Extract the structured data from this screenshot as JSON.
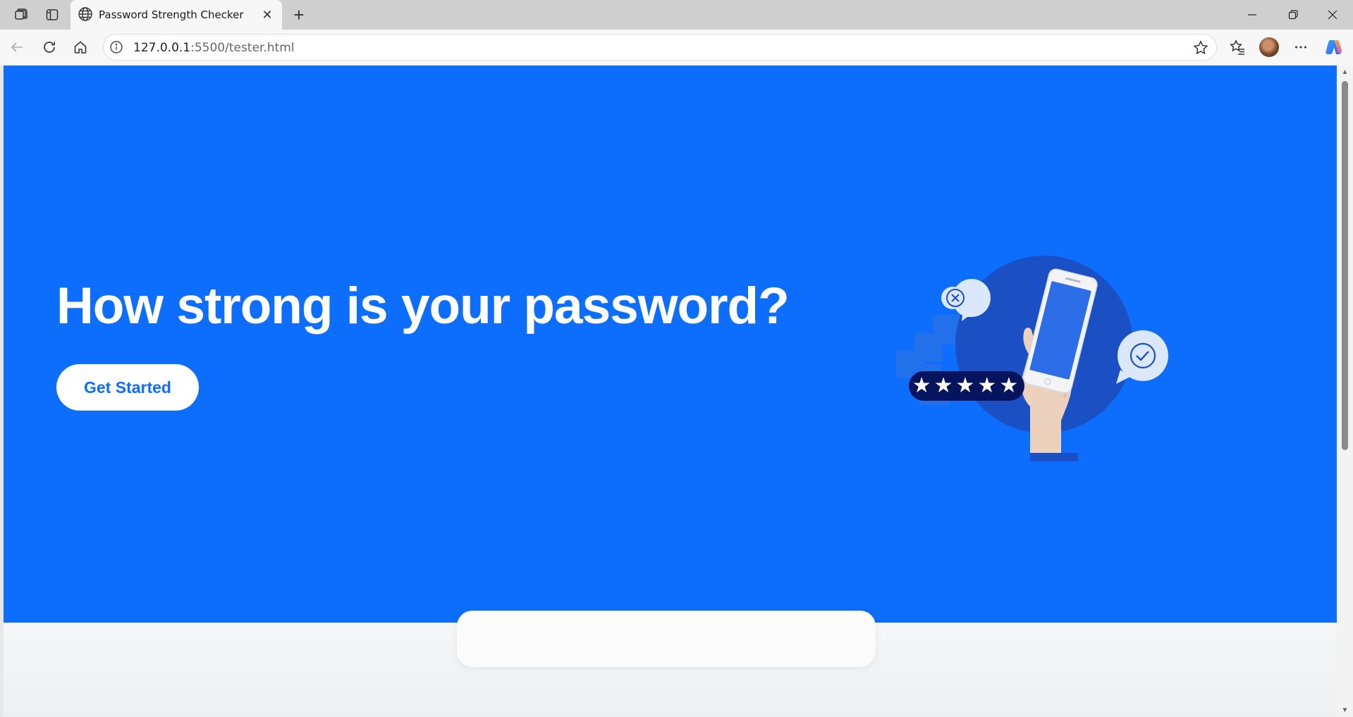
{
  "browser": {
    "tab_title": "Password Strength Checker",
    "tab_close": "✕",
    "new_tab": "+",
    "url_host": "127.0.0.1",
    "url_rest": ":5500/tester.html"
  },
  "hero": {
    "headline": "How strong is your password?",
    "cta_label": "Get Started",
    "illustration_mask": "★★★★★"
  },
  "colors": {
    "hero_bg": "#0d6efd",
    "cta_text": "#0d6efd",
    "dark_circle": "#1b4fc4",
    "mask_pill": "#06145e"
  },
  "icons": {
    "workspaces": "workspaces-icon",
    "vertical_tabs": "vertical-tabs-icon",
    "globe": "globe-icon",
    "back": "back-arrow-icon",
    "reload": "reload-icon",
    "home": "home-icon",
    "site_info": "info-icon",
    "favorite": "star-icon",
    "favorites": "favorites-icon",
    "more": "more-icon",
    "copilot": "copilot-icon"
  }
}
